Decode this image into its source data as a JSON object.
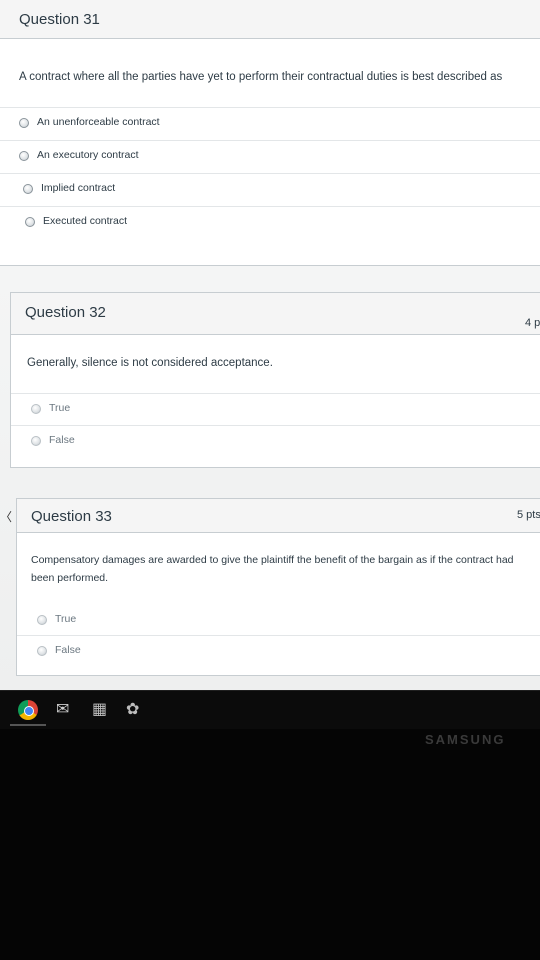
{
  "questions": [
    {
      "title": "Question 31",
      "points": "",
      "text": "A contract where all the parties have yet to perform their contractual duties is best described as",
      "answers": [
        "An unenforceable contract",
        "An executory contract",
        "Implied contract",
        "Executed contract"
      ]
    },
    {
      "title": "Question 32",
      "points": "4 p",
      "text": "Generally, silence is not considered acceptance.",
      "answers": [
        "True",
        "False"
      ]
    },
    {
      "title": "Question 33",
      "points": "5 pts",
      "text": "Compensatory damages are awarded to give the plaintiff the benefit of the bargain as if the contract had been performed.",
      "answers": [
        "True",
        "False"
      ]
    }
  ],
  "taskbar": {
    "icons": [
      "chrome-icon",
      "mail-icon",
      "calculator-icon",
      "apps-icon"
    ]
  },
  "bezel": {
    "brand": "SAMSUNG"
  }
}
